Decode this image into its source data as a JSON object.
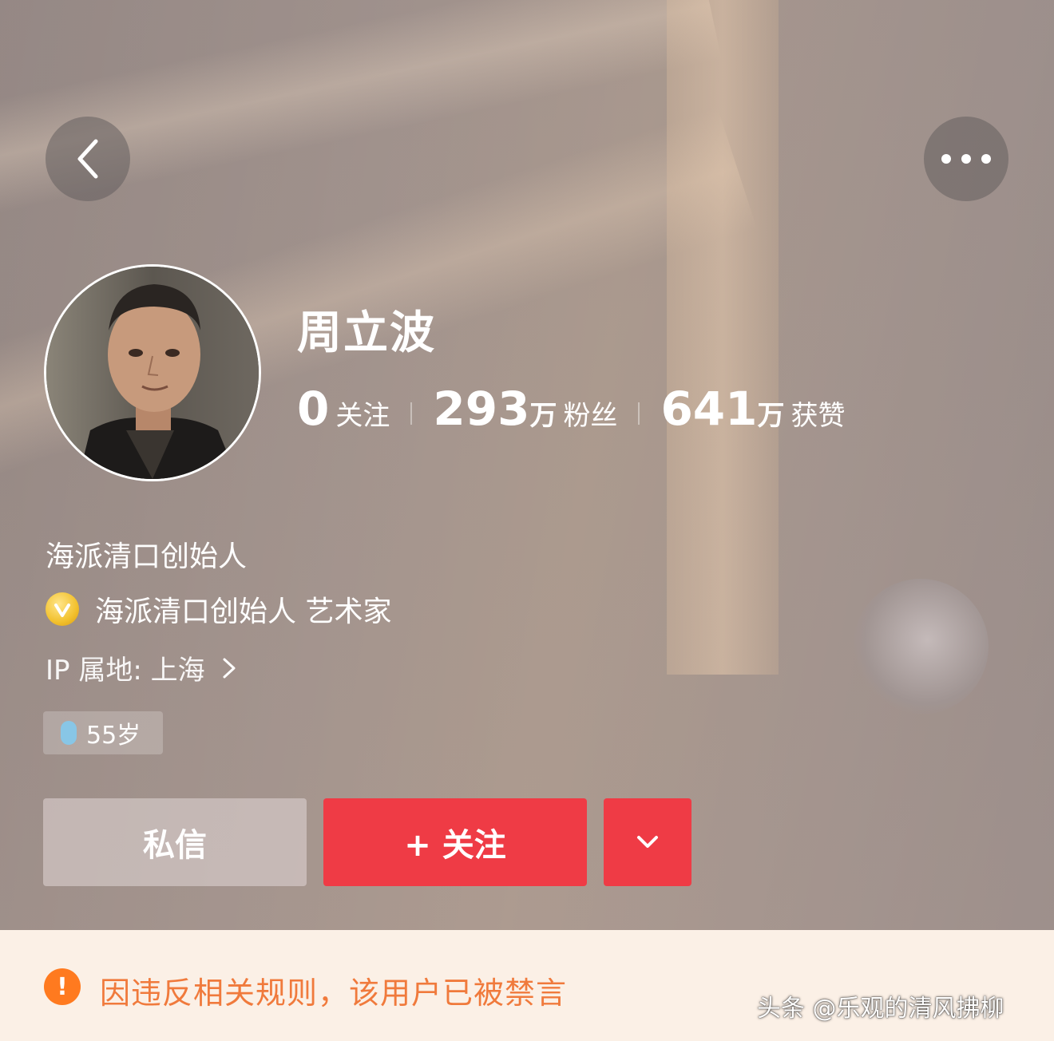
{
  "profile": {
    "name": "周立波",
    "stats": [
      {
        "num": "0",
        "unit": "",
        "label": "关注"
      },
      {
        "num": "293",
        "unit": "万",
        "label": "粉丝"
      },
      {
        "num": "641",
        "unit": "万",
        "label": "获赞"
      }
    ],
    "bio": "海派清口创始人",
    "verification": "海派清口创始人 艺术家",
    "ip_location": "IP 属地: 上海",
    "age_tag": "55岁"
  },
  "actions": {
    "message_label": "私信",
    "follow_label": "+ 关注"
  },
  "notice": {
    "text": "因违反相关规则，该用户已被禁言",
    "icon": "!"
  },
  "watermark": "头条 @乐观的清风拂柳",
  "icons": {
    "back": "chevron-left-icon",
    "more": "more-dots-icon",
    "verify": "verified-badge-icon",
    "ip_chevron": "chevron-right-icon",
    "dropdown": "chevron-down-icon",
    "warning": "warning-icon"
  },
  "colors": {
    "follow_button": "#ef3b45",
    "notice_text": "#f07a3c",
    "notice_icon": "#ff7a1f",
    "notice_bg": "#fbf0e6"
  }
}
